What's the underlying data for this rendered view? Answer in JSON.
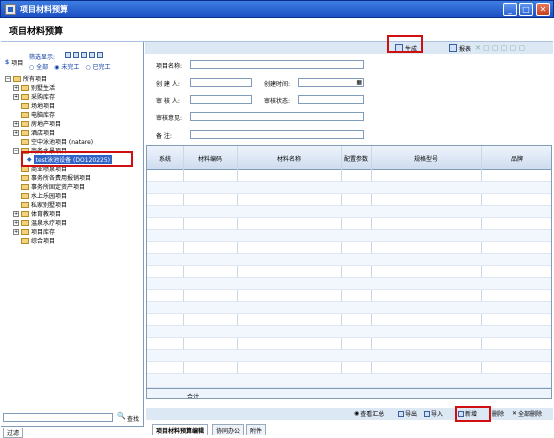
{
  "window": {
    "title": "项目材料预算"
  },
  "header": {
    "title": "项目材料预算"
  },
  "toolbar": {
    "generate_label": "生成",
    "report_label": "报表"
  },
  "left_panel": {
    "project_label": "项目",
    "filter_label": "筛选显示:",
    "filter_options": [
      "全部",
      "未完工",
      "已完工"
    ],
    "filter_selected": "未完工",
    "tree": [
      {
        "label": "所有项目",
        "level": 0
      },
      {
        "label": "别墅生活",
        "level": 1
      },
      {
        "label": "采购库存",
        "level": 1
      },
      {
        "label": "场地项目",
        "level": 1
      },
      {
        "label": "电脑库存",
        "level": 1
      },
      {
        "label": "房地产项目",
        "level": 1
      },
      {
        "label": "酒店项目",
        "level": 1
      },
      {
        "label": "空中泳池项目 (natare)",
        "level": 1
      },
      {
        "label": "商务水景项目",
        "level": 1
      },
      {
        "label": "test泳池设备 (DO120225)",
        "level": 2,
        "selected": true
      },
      {
        "label": "商业喷泉项目",
        "level": 1
      },
      {
        "label": "事务所各费用报销项目",
        "level": 1
      },
      {
        "label": "事务所固定资产项目",
        "level": 1
      },
      {
        "label": "水上乐园项目",
        "level": 1
      },
      {
        "label": "私家别墅项目",
        "level": 1
      },
      {
        "label": "体育教项目",
        "level": 1
      },
      {
        "label": "温泉水疗项目",
        "level": 1
      },
      {
        "label": "项目库存",
        "level": 1
      },
      {
        "label": "综合项目",
        "level": 1
      }
    ],
    "search_label": "查找",
    "tab_label": "过滤"
  },
  "form": {
    "project_name_label": "项目名称:",
    "creator_label": "创 建 人:",
    "create_time_label": "创建时间:",
    "reviewer_label": "审 核 人:",
    "review_status_label": "审核状态:",
    "review_comment_label": "审核意见:",
    "remark_label": "备    注:"
  },
  "grid": {
    "columns": [
      "系统",
      "材料编码",
      "材料名称",
      "配置参数",
      "规格型号",
      "品牌"
    ],
    "footer_label": "合计"
  },
  "bottom_toolbar": {
    "view_summary": "查看汇总",
    "export": "导出",
    "import": "导入",
    "add": "新增",
    "delete": "删除",
    "delete_all": "全部删除"
  },
  "tabs": [
    "项目材料预算编辑",
    "协同办公",
    "附件"
  ]
}
